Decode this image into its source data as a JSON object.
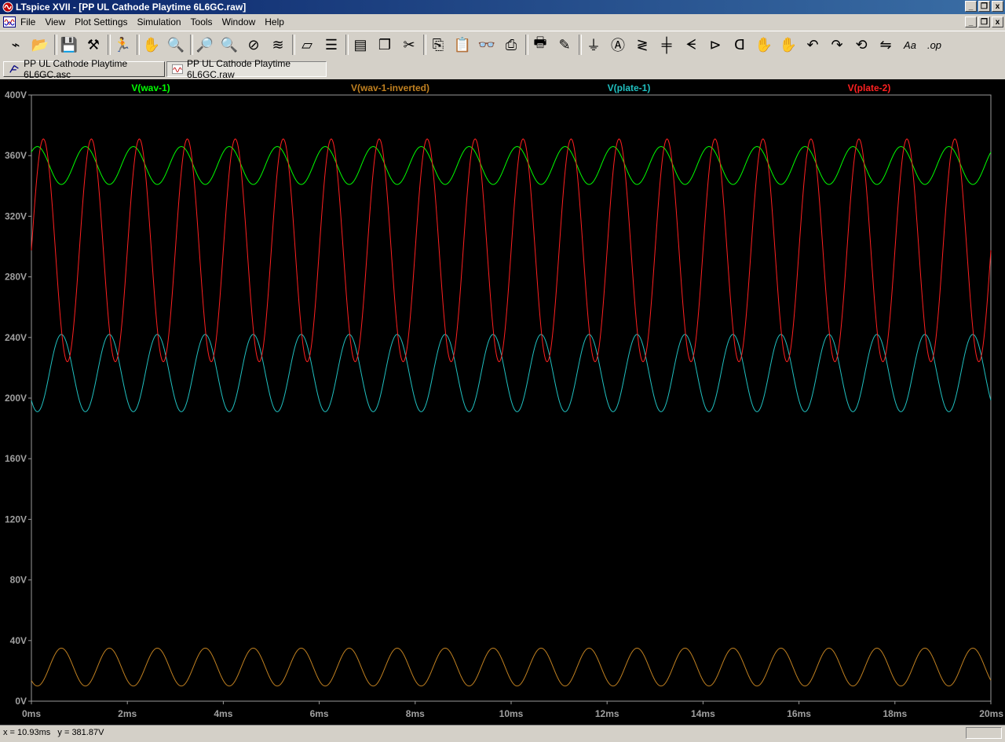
{
  "window": {
    "title": "LTspice XVII - [PP UL Cathode Playtime 6L6GC.raw]",
    "minimize_glyph": "_",
    "restore_glyph": "❐",
    "close_glyph": "x"
  },
  "menu": [
    "File",
    "View",
    "Plot Settings",
    "Simulation",
    "Tools",
    "Window",
    "Help"
  ],
  "toolbar_icons": [
    "control-panel",
    "open",
    "save",
    "hammer",
    "run",
    "halt",
    "zoom-in",
    "zoom-pan",
    "zoom-out",
    "zoom-cancel",
    "autorange",
    "rulers",
    "tile-horizontal",
    "tile-vertical",
    "cascade",
    "cut",
    "copy",
    "paste",
    "find",
    "print-setup",
    "print",
    "draw-wire",
    "ground",
    "label-net",
    "resistor",
    "capacitor",
    "inductor",
    "diode",
    "component",
    "move",
    "drag",
    "undo",
    "redo",
    "rotate",
    "mirror",
    "text",
    "spice-directive"
  ],
  "tabs": [
    {
      "label": "PP UL Cathode Playtime 6L6GC.asc",
      "icon": "schematic-icon"
    },
    {
      "label": "PP UL Cathode Playtime 6L6GC.raw",
      "icon": "waveform-icon"
    }
  ],
  "status": {
    "x": "x = 10.93ms",
    "y": "y = 381.87V"
  },
  "chart_data": {
    "type": "line",
    "background": "#000000",
    "xlim": [
      0,
      20
    ],
    "ylim": [
      0,
      400
    ],
    "x_ticks": [
      "0ms",
      "2ms",
      "4ms",
      "6ms",
      "8ms",
      "10ms",
      "12ms",
      "14ms",
      "16ms",
      "18ms",
      "20ms"
    ],
    "y_ticks": [
      "0V",
      "40V",
      "80V",
      "120V",
      "160V",
      "200V",
      "240V",
      "280V",
      "320V",
      "360V",
      "400V"
    ],
    "series": [
      {
        "name": "V(wav-1)",
        "color": "#00ff00",
        "offset": 353.5,
        "amplitude": 12.5,
        "frequency_khz": 1.0,
        "phase_deg": 45
      },
      {
        "name": "V(wav-1-inverted)",
        "color": "#c08020",
        "offset": 22.5,
        "amplitude": 12.5,
        "frequency_khz": 1.0,
        "phase_deg": -135
      },
      {
        "name": "V(plate-1)",
        "color": "#20c0c0",
        "offset": 216.5,
        "amplitude": 25.5,
        "frequency_khz": 1.0,
        "phase_deg": -135
      },
      {
        "name": "V(plate-2)",
        "color": "#ff2020",
        "offset": 297.5,
        "amplitude": 73.5,
        "frequency_khz": 1.0,
        "phase_deg": 0
      }
    ],
    "legend_placement": "top"
  }
}
